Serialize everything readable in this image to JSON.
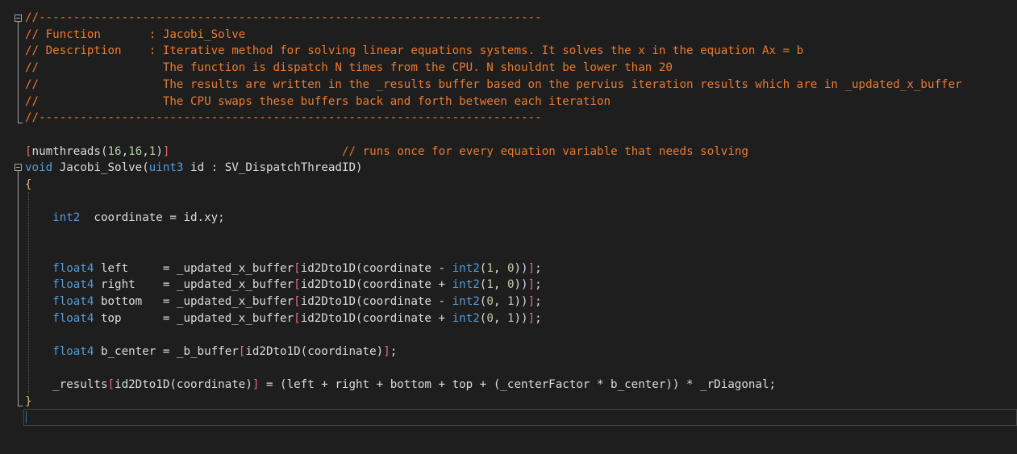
{
  "editor": {
    "lines": [
      "//-------------------------------------------------------------------------",
      "// Function       : Jacobi_Solve",
      "// Description    : Iterative method for solving linear equations systems. It solves the x in the equation Ax = b",
      "//                  The function is dispatch N times from the CPU. N shouldnt be lower than 20",
      "//                  The results are written in the _results buffer based on the pervius iteration results which are in _updated_x_buffer",
      "//                  The CPU swaps these buffers back and forth between each iteration",
      "//-------------------------------------------------------------------------",
      "",
      "[numthreads(16,16,1)]                         // runs once for every equation variable that needs solving",
      "void Jacobi_Solve(uint3 id : SV_DispatchThreadID)",
      "{",
      "",
      "    int2  coordinate = id.xy;",
      "",
      "",
      "    float4 left     = _updated_x_buffer[id2Dto1D(coordinate - int2(1, 0))];",
      "    float4 right    = _updated_x_buffer[id2Dto1D(coordinate + int2(1, 0))];",
      "    float4 bottom   = _updated_x_buffer[id2Dto1D(coordinate - int2(0, 1))];",
      "    float4 top      = _updated_x_buffer[id2Dto1D(coordinate + int2(0, 1))];",
      "",
      "    float4 b_center = _b_buffer[id2Dto1D(coordinate)];",
      "",
      "    _results[id2Dto1D(coordinate)] = (left + right + bottom + top + (_centerFactor * b_center)) * _rDiagonal;",
      "}"
    ],
    "colors": {
      "background": "#1e1e1e",
      "comment": "#ec7a2f",
      "keyword": "#569cd6",
      "text": "#dcdcdc",
      "number": "#b5cea8"
    }
  }
}
